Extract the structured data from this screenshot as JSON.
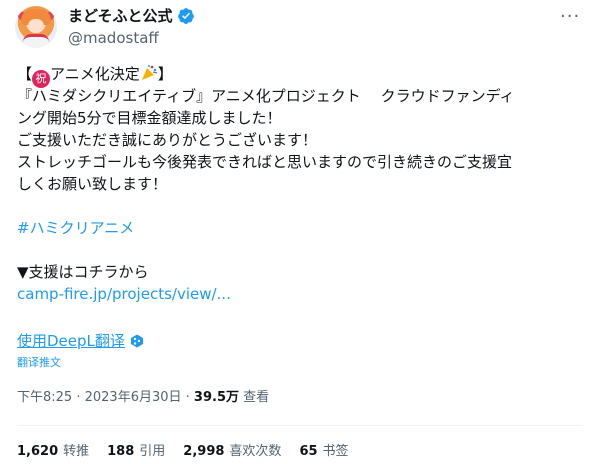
{
  "author": {
    "display_name": "まどそふと公式",
    "handle": "@madostaff"
  },
  "tweet": {
    "line1_prefix": "【",
    "line1_badge": "祝",
    "line1_text": "アニメ化決定",
    "line1_suffix": "】",
    "line2": "『ハミダシクリエイティブ』アニメ化プロジェクト　 クラウドファンディ",
    "line3": "ング開始5分で目標金額達成しました！",
    "line4": "ご支援いただき誠にありがとうございます！",
    "line5": "ストレッチゴールも今後発表できればと思いますので引き続きのご支援宜",
    "line6": "しくお願い致します！",
    "hashtag": "#ハミクリアニメ",
    "support_line": "▼支援はコチラから",
    "link": "camp-fire.jp/projects/view/..."
  },
  "translate": {
    "label": "使用DeepL翻译",
    "tweet_label": "翻译推文"
  },
  "meta": {
    "time": "下午8:25",
    "date": "2023年6月30日",
    "views_count": "39.5万",
    "views_label": "查看"
  },
  "stats": {
    "retweets_count": "1,620",
    "retweets_label": "转推",
    "quotes_count": "188",
    "quotes_label": "引用",
    "likes_count": "2,998",
    "likes_label": "喜欢次数",
    "bookmarks_count": "65",
    "bookmarks_label": "书签"
  },
  "colors": {
    "accent": "#1d9bf0",
    "secondary_text": "#536471",
    "badge_red": "#e0245e"
  }
}
